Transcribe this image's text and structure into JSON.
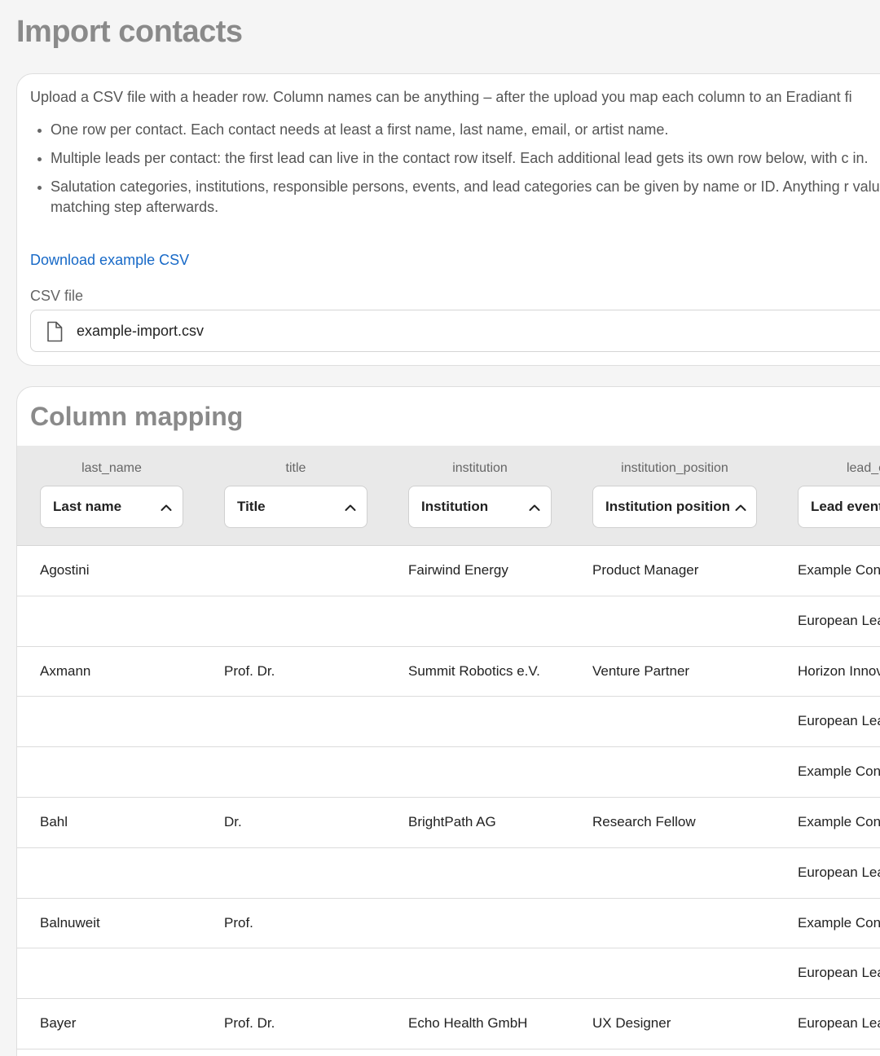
{
  "page": {
    "title": "Import contacts"
  },
  "upload": {
    "intro": "Upload a CSV file with a header row. Column names can be anything – after the upload you map each column to an Eradiant fi",
    "bullets": [
      "One row per contact. Each contact needs at least a first name, last name, email, or artist name.",
      "Multiple leads per contact: the first lead can live in the contact row itself. Each additional lead gets its own row below, with c in.",
      "Salutation categories, institutions, responsible persons, events, and lead categories can be given by name or ID. Anything r value matching step afterwards."
    ],
    "download_label": "Download example CSV",
    "file_label": "CSV file",
    "file_name": "example-import.csv",
    "file_icon": "file-icon"
  },
  "mapping": {
    "title": "Column mapping",
    "columns": [
      {
        "name": "last_name",
        "selected": "Last name"
      },
      {
        "name": "title",
        "selected": "Title"
      },
      {
        "name": "institution",
        "selected": "Institution"
      },
      {
        "name": "institution_position",
        "selected": "Institution position"
      },
      {
        "name": "lead_ev",
        "selected": "Lead event"
      }
    ],
    "rows": [
      [
        "Agostini",
        "",
        "Fairwind Energy",
        "Product Manager",
        "Example Con"
      ],
      [
        "",
        "",
        "",
        "",
        "European Lea"
      ],
      [
        "Axmann",
        "Prof. Dr.",
        "Summit Robotics e.V.",
        "Venture Partner",
        "Horizon Innov"
      ],
      [
        "",
        "",
        "",
        "",
        "European Lea"
      ],
      [
        "",
        "",
        "",
        "",
        "Example Con"
      ],
      [
        "Bahl",
        "Dr.",
        "BrightPath AG",
        "Research Fellow",
        "Example Con"
      ],
      [
        "",
        "",
        "",
        "",
        "European Lea"
      ],
      [
        "Balnuweit",
        "Prof.",
        "",
        "",
        "Example Con"
      ],
      [
        "",
        "",
        "",
        "",
        "European Lea"
      ],
      [
        "Bayer",
        "Prof. Dr.",
        "Echo Health GmbH",
        "UX Designer",
        "European Lea"
      ]
    ]
  },
  "icons": {
    "select_toggle": "chevron-up-icon"
  }
}
